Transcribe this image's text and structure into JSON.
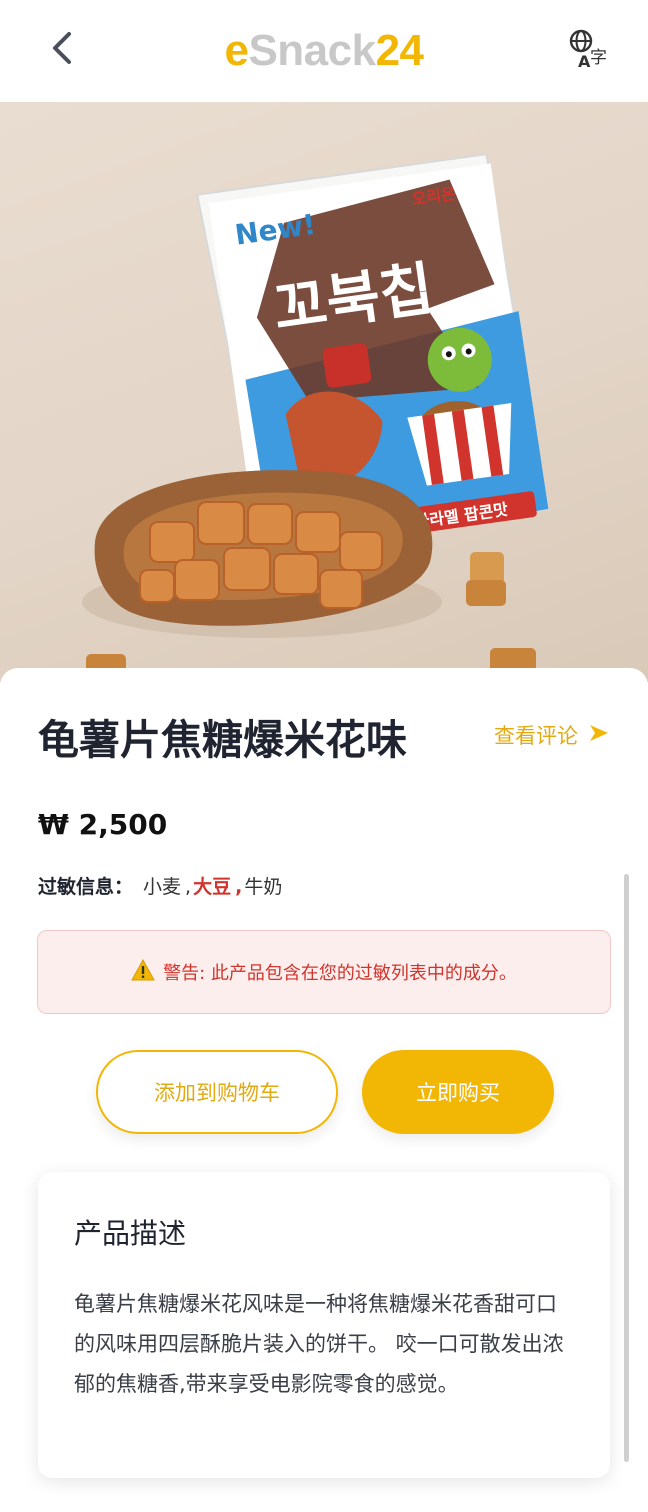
{
  "header": {
    "logo_e": "e",
    "logo_mid": "Snack",
    "logo_num": "24",
    "back_icon": "chevron-left-icon",
    "lang_icon": "translate-icon"
  },
  "hero": {
    "bag_badge": "New!",
    "bag_title": "꼬북칩",
    "bag_flavor": "카라멜 팝콘맛",
    "bag_brand": "오리온"
  },
  "product": {
    "title": "龟薯片焦糖爆米花味",
    "reviews_label": "查看评论",
    "price": "₩ 2,500",
    "allergy_label": "过敏信息：",
    "allergens": [
      "小麦",
      "大豆",
      "牛奶"
    ],
    "allergen_sep_1": ",",
    "allergen_sep_2": ",",
    "warning_text": "警告: 此产品包含在您的过敏列表中的成分。",
    "add_to_cart": "添加到购物车",
    "buy_now": "立即购买",
    "description_title": "产品描述",
    "description_text": "龟薯片焦糖爆米花风味是一种将焦糖爆米花香甜可口的风味用四层酥脆片装入的饼干。 咬一口可散发出浓郁的焦糖香,带来享受电影院零食的感觉。"
  },
  "colors": {
    "accent": "#f2b705",
    "warning_red": "#d0342c",
    "warning_bg": "#fdeeee"
  }
}
